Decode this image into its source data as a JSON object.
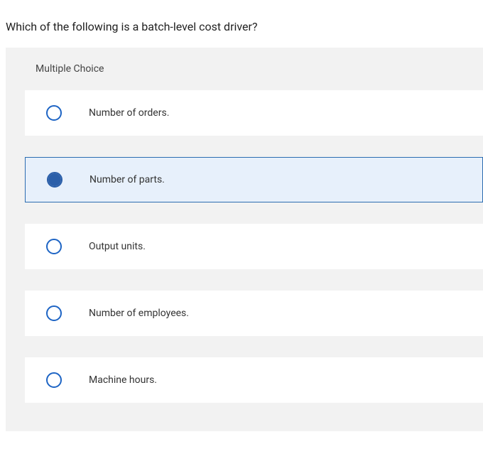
{
  "question": "Which of the following is a batch-level cost driver?",
  "section_header": "Multiple Choice",
  "options": [
    {
      "label": "Number of orders.",
      "selected": false
    },
    {
      "label": "Number of parts.",
      "selected": true
    },
    {
      "label": "Output units.",
      "selected": false
    },
    {
      "label": "Number of employees.",
      "selected": false
    },
    {
      "label": "Machine hours.",
      "selected": false
    }
  ]
}
